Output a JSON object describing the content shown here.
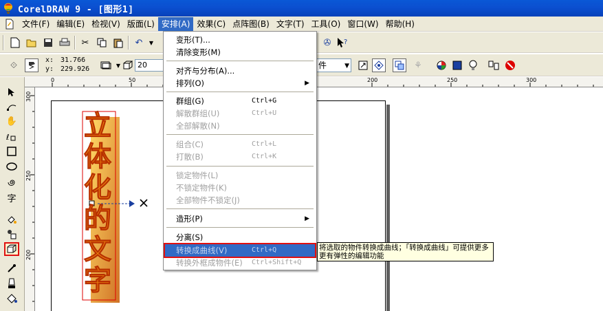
{
  "window": {
    "title": "CorelDRAW 9 - [图形1]"
  },
  "menubar": {
    "items": [
      {
        "label": "文件(F)"
      },
      {
        "label": "编辑(E)"
      },
      {
        "label": "检视(V)"
      },
      {
        "label": "版面(L)"
      },
      {
        "label": "安排(A)",
        "active": true
      },
      {
        "label": "效果(C)"
      },
      {
        "label": "点阵图(B)"
      },
      {
        "label": "文字(T)"
      },
      {
        "label": "工具(O)"
      },
      {
        "label": "窗口(W)"
      },
      {
        "label": "帮助(H)"
      }
    ]
  },
  "property_bar": {
    "x_label": "x:",
    "x_value": "31.766",
    "y_label": "y:",
    "y_value": "229.926",
    "depth_value": "20",
    "object_combo": "件"
  },
  "ruler": {
    "h_labels": [
      "0",
      "50",
      "200",
      "250",
      "300"
    ],
    "v_labels": [
      "300",
      "250",
      "200"
    ]
  },
  "canvas_text": "立体化的文字",
  "arrange_menu": {
    "items": [
      {
        "label": "变形(T)...",
        "shortcut": "",
        "disabled": false
      },
      {
        "label": "清除变形(M)",
        "shortcut": "",
        "disabled": false
      },
      {
        "label": "对齐与分布(A)...",
        "shortcut": "",
        "disabled": false
      },
      {
        "label": "排列(O)",
        "shortcut": "",
        "disabled": false,
        "submenu": true
      },
      {
        "label": "群组(G)",
        "shortcut": "Ctrl+G",
        "disabled": false
      },
      {
        "label": "解散群组(U)",
        "shortcut": "Ctrl+U",
        "disabled": true
      },
      {
        "label": "全部解散(N)",
        "shortcut": "",
        "disabled": true
      },
      {
        "label": "组合(C)",
        "shortcut": "Ctrl+L",
        "disabled": true
      },
      {
        "label": "打散(B)",
        "shortcut": "Ctrl+K",
        "disabled": true
      },
      {
        "label": "锁定物件(L)",
        "shortcut": "",
        "disabled": true
      },
      {
        "label": "不锁定物件(K)",
        "shortcut": "",
        "disabled": true
      },
      {
        "label": "全部物件不锁定(J)",
        "shortcut": "",
        "disabled": true
      },
      {
        "label": "造形(P)",
        "shortcut": "",
        "disabled": false,
        "submenu": true
      },
      {
        "label": "分离(S)",
        "shortcut": "",
        "disabled": false
      },
      {
        "label": "转换成曲线(V)",
        "shortcut": "Ctrl+Q",
        "disabled": false,
        "highlighted": true
      },
      {
        "label": "转换外框成物件(E)",
        "shortcut": "Ctrl+Shift+Q",
        "disabled": true
      }
    ],
    "submenu_arrow": "▶"
  },
  "tooltip": {
    "text": "将选取的物件转换成曲线；「转换成曲线」可提供更多更有弹性的编辑功能"
  },
  "colors": {
    "titlebar": "#0a58d6",
    "menu_highlight": "#316ac5",
    "annotation_red": "#e01010",
    "text_fill": "#f08a10"
  }
}
